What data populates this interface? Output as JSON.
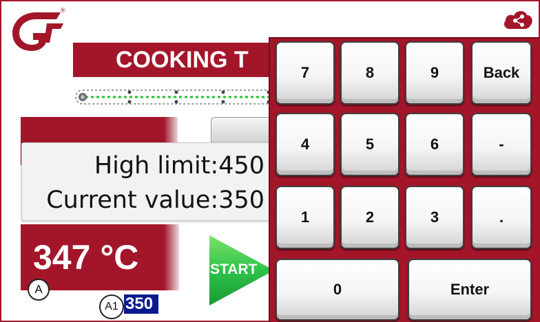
{
  "header": {
    "brand_mark": "G",
    "registered": "®",
    "title": "COOKING T",
    "cloud_icon": "cloud-share-icon"
  },
  "panel": {
    "set_temp_partial": "",
    "grey_button_partial": ""
  },
  "tooltip": {
    "high_limit": "High limit:450",
    "current_value": "Current value:350"
  },
  "current_temp": {
    "value": "347 °C",
    "marker": "A"
  },
  "readout": {
    "marker": "A1",
    "value": "350"
  },
  "start_button": {
    "label": "START"
  },
  "keypad": {
    "keys": [
      "7",
      "8",
      "9",
      "Back",
      "4",
      "5",
      "6",
      "-",
      "1",
      "2",
      "3",
      ".",
      "0",
      "Enter"
    ]
  },
  "colors": {
    "brand": "#a3162a",
    "readout_bg": "#0b1a8f",
    "start_green": "#2fc24a"
  }
}
